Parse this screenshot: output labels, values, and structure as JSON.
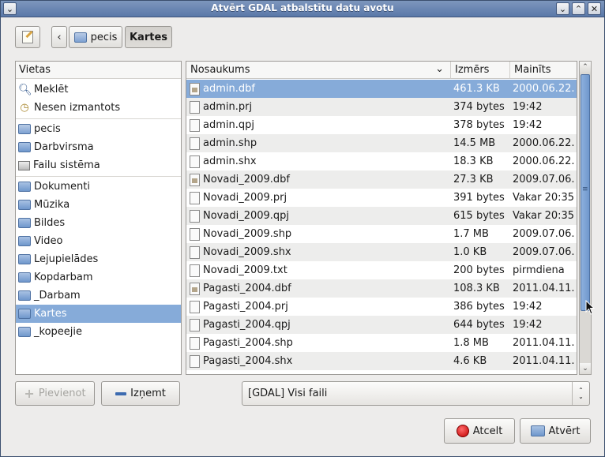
{
  "window": {
    "title": "Atvērt GDAL atbalstītu datu avotu"
  },
  "titlebar": {
    "menu_glyph": "⌄",
    "minimize_glyph": "⌄",
    "maximize_glyph": "⌃",
    "close_glyph": "✕"
  },
  "pathbar": {
    "back_glyph": "‹",
    "crumbs": [
      "pecis",
      "Kartes"
    ]
  },
  "places": {
    "header": "Vietas",
    "items": [
      {
        "label": "Meklēt",
        "icon": "search-icon"
      },
      {
        "label": "Nesen izmantots",
        "icon": "recent-icon"
      },
      {
        "label": "pecis",
        "icon": "home-folder-icon"
      },
      {
        "label": "Darbvirsma",
        "icon": "folder-icon"
      },
      {
        "label": "Failu sistēma",
        "icon": "drive-icon"
      },
      {
        "label": "Dokumenti",
        "icon": "folder-icon"
      },
      {
        "label": "Mūzika",
        "icon": "folder-icon"
      },
      {
        "label": "Bildes",
        "icon": "folder-icon"
      },
      {
        "label": "Video",
        "icon": "folder-icon"
      },
      {
        "label": "Lejupielādes",
        "icon": "folder-icon"
      },
      {
        "label": "Kopdarbam",
        "icon": "folder-icon"
      },
      {
        "label": "_Darbam",
        "icon": "folder-icon"
      },
      {
        "label": "Kartes",
        "icon": "folder-icon"
      },
      {
        "label": "_kopeejie",
        "icon": "folder-icon"
      }
    ]
  },
  "files": {
    "columns": {
      "name": "Nosaukums",
      "size": "Izmērs",
      "modified": "Mainīts"
    },
    "sort_glyph": "⌄",
    "rows": [
      {
        "name": "admin.dbf",
        "size": "461.3 KB",
        "modified": "2000.06.22.",
        "db": true
      },
      {
        "name": "admin.prj",
        "size": "374 bytes",
        "modified": "19:42",
        "db": false
      },
      {
        "name": "admin.qpj",
        "size": "378 bytes",
        "modified": "19:42",
        "db": false
      },
      {
        "name": "admin.shp",
        "size": "14.5 MB",
        "modified": "2000.06.22.",
        "db": false
      },
      {
        "name": "admin.shx",
        "size": "18.3 KB",
        "modified": "2000.06.22.",
        "db": false
      },
      {
        "name": "Novadi_2009.dbf",
        "size": "27.3 KB",
        "modified": "2009.07.06.",
        "db": true
      },
      {
        "name": "Novadi_2009.prj",
        "size": "391 bytes",
        "modified": "Vakar 20:35",
        "db": false
      },
      {
        "name": "Novadi_2009.qpj",
        "size": "615 bytes",
        "modified": "Vakar 20:35",
        "db": false
      },
      {
        "name": "Novadi_2009.shp",
        "size": "1.7 MB",
        "modified": "2009.07.06.",
        "db": false
      },
      {
        "name": "Novadi_2009.shx",
        "size": "1.0 KB",
        "modified": "2009.07.06.",
        "db": false
      },
      {
        "name": "Novadi_2009.txt",
        "size": "200 bytes",
        "modified": "pirmdiena",
        "db": false
      },
      {
        "name": "Pagasti_2004.dbf",
        "size": "108.3 KB",
        "modified": "2011.04.11.",
        "db": true
      },
      {
        "name": "Pagasti_2004.prj",
        "size": "386 bytes",
        "modified": "19:42",
        "db": false
      },
      {
        "name": "Pagasti_2004.qpj",
        "size": "644 bytes",
        "modified": "19:42",
        "db": false
      },
      {
        "name": "Pagasti_2004.shp",
        "size": "1.8 MB",
        "modified": "2011.04.11.",
        "db": false
      },
      {
        "name": "Pagasti_2004.shx",
        "size": "4.6 KB",
        "modified": "2011.04.11.",
        "db": false
      }
    ]
  },
  "scrollbar": {
    "up_glyph": "⌃",
    "down_glyph": "⌄",
    "grip_glyph": "≡"
  },
  "buttons": {
    "add": "Pievienot",
    "remove": "Izņemt",
    "cancel": "Atcelt",
    "open": "Atvērt"
  },
  "filter": {
    "value": "[GDAL] Visi faili",
    "up_glyph": "⌃",
    "down_glyph": "⌄"
  }
}
